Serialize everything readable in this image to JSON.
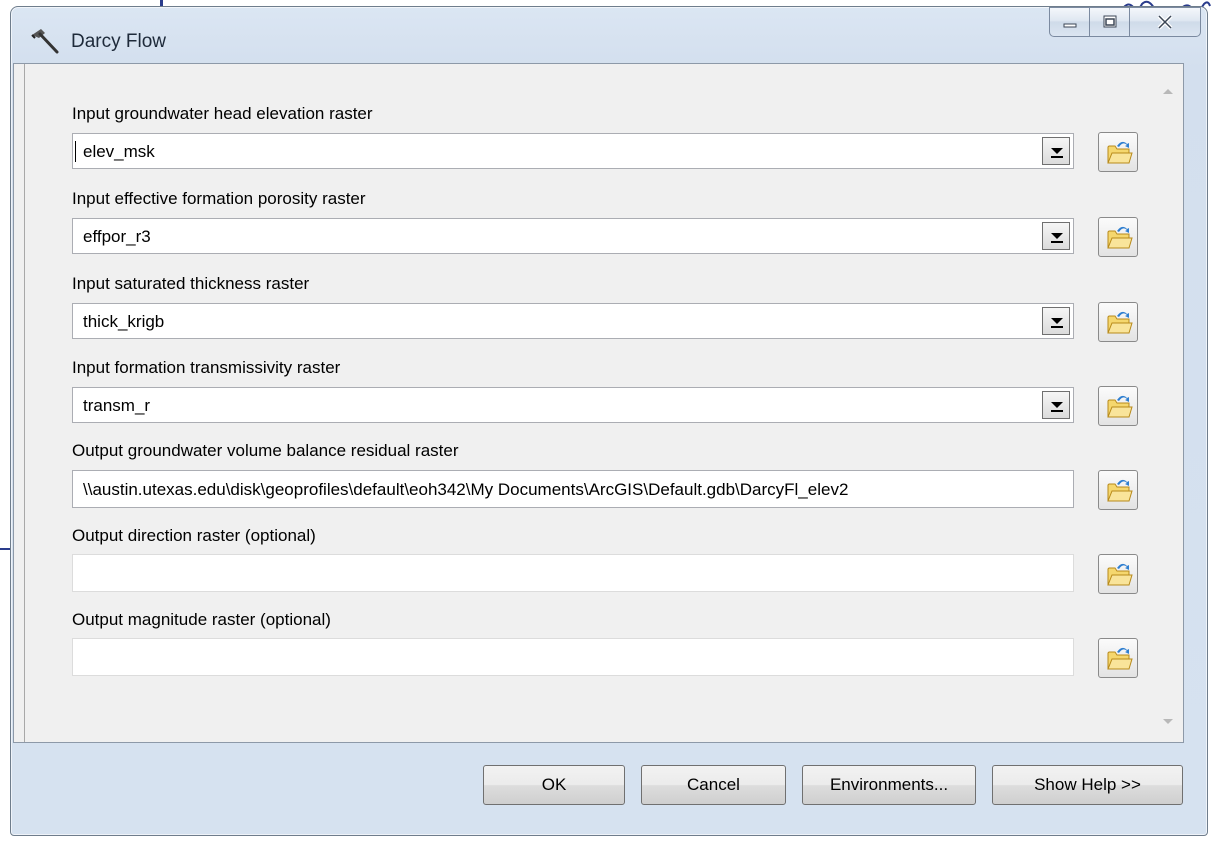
{
  "window": {
    "title": "Darcy Flow"
  },
  "fields": [
    {
      "label": "Input groundwater head elevation raster",
      "value": "elev_msk",
      "kind": "combo"
    },
    {
      "label": "Input effective formation porosity raster",
      "value": "effpor_r3",
      "kind": "combo"
    },
    {
      "label": "Input saturated thickness raster",
      "value": "thick_krigb",
      "kind": "combo"
    },
    {
      "label": "Input formation transmissivity raster",
      "value": "transm_r",
      "kind": "combo"
    },
    {
      "label": "Output groundwater volume balance residual raster",
      "value": "\\\\austin.utexas.edu\\disk\\geoprofiles\\default\\eoh342\\My Documents\\ArcGIS\\Default.gdb\\DarcyFl_elev2",
      "kind": "text"
    },
    {
      "label": "Output direction raster (optional)",
      "value": "",
      "kind": "text"
    },
    {
      "label": "Output magnitude raster (optional)",
      "value": "",
      "kind": "text"
    }
  ],
  "buttons": {
    "ok": "OK",
    "cancel": "Cancel",
    "environments": "Environments...",
    "show_help": "Show Help >>"
  },
  "icons": {
    "app": "hammer-icon",
    "browse": "open-folder-icon",
    "minimize": "minimize-icon",
    "maximize": "maximize-icon",
    "close": "close-icon"
  }
}
